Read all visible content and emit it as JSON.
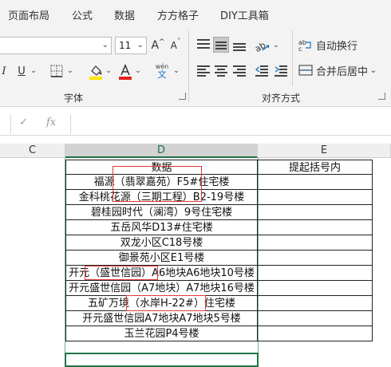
{
  "tabs": [
    "页面布局",
    "公式",
    "数据",
    "方方格子",
    "DIY工具箱"
  ],
  "ribbon": {
    "font_name": "",
    "font_size": "11",
    "grow_font": "A",
    "shrink_font": "A",
    "italic": "I",
    "underline": "U",
    "phonetic_top": "wén",
    "phonetic_bottom": "文",
    "font_group_label": "字体",
    "wrap_text": "自动换行",
    "merge_center": "合并后居中",
    "align_group_label": "对齐方式",
    "fill_color": "#ffe600",
    "font_color": "#e02020"
  },
  "formula_bar": {
    "cancel": "✓",
    "fx": "fx",
    "value": ""
  },
  "columns": [
    "C",
    "D",
    "E"
  ],
  "sheet": {
    "header_d": "数据",
    "header_e": "提起括号内",
    "rows": [
      "福源（翡翠嘉苑）F5#住宅楼",
      "金科桃花源（三期工程）B2-19号楼",
      "碧桂园时代（澜湾）9号住宅楼",
      "五岳风华D13#住宅楼",
      "双龙小区C18号楼",
      "御景苑小区E1号楼",
      "开元（盛世信园）A6地块A6地块10号楼",
      "开元盛世信园（A7地块）A7地块16号楼",
      "五矿万境（水岸H-22#）住宅楼",
      "开元盛世信园A7地块A7地块5号楼",
      "玉兰花园P4号楼"
    ]
  },
  "colors": {
    "selected_col": "#217346",
    "annotation": "#e23b3b"
  }
}
